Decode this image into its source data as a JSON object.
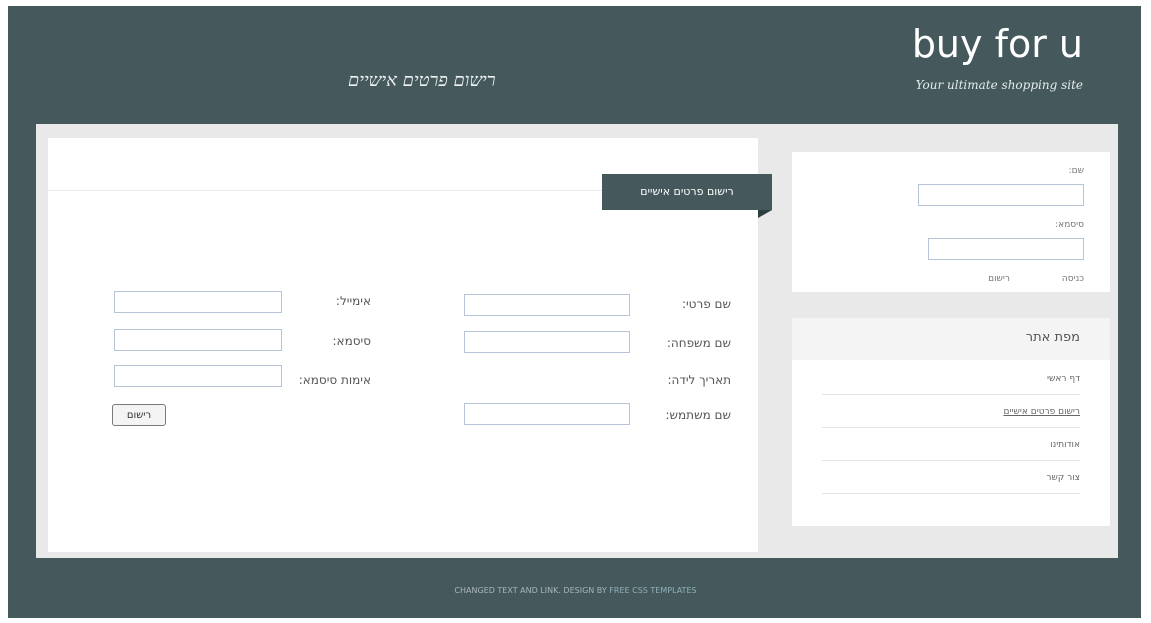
{
  "header": {
    "logo_title": "buy for u",
    "logo_tagline": "Your ultimate shopping site",
    "page_heading": "רישום פרטים אישיים"
  },
  "main": {
    "section_tab": "רישום פרטים אישיים",
    "fields": {
      "first_name_label": "שם פרטי:",
      "last_name_label": "שם משפחה:",
      "birth_date_label": "תאריך לידה:",
      "username_label": "שם משתמש:",
      "email_label": "אימייל:",
      "password_label": "סיסמא:",
      "confirm_password_label": "אימות סיסמא:"
    },
    "submit_label": "רישום"
  },
  "sidebar": {
    "login": {
      "username_label": "שם:",
      "password_label": "סיסמא:",
      "register_link": "רישום",
      "login_link": "כניסה"
    },
    "nav": {
      "title": "מפת אתר",
      "items": [
        {
          "label": "דף ראשי"
        },
        {
          "label": "רישום פרטים אישיים"
        },
        {
          "label": "אודותינו"
        },
        {
          "label": "צור קשר"
        }
      ]
    }
  },
  "footer": {
    "text": "CHANGED TEXT AND LINK. DESIGN BY",
    "link": "FREE CSS TEMPLATES"
  },
  "colors": {
    "frame": "#45595d",
    "content_bg": "#e9e9e9",
    "panel_bg": "#ffffff"
  }
}
